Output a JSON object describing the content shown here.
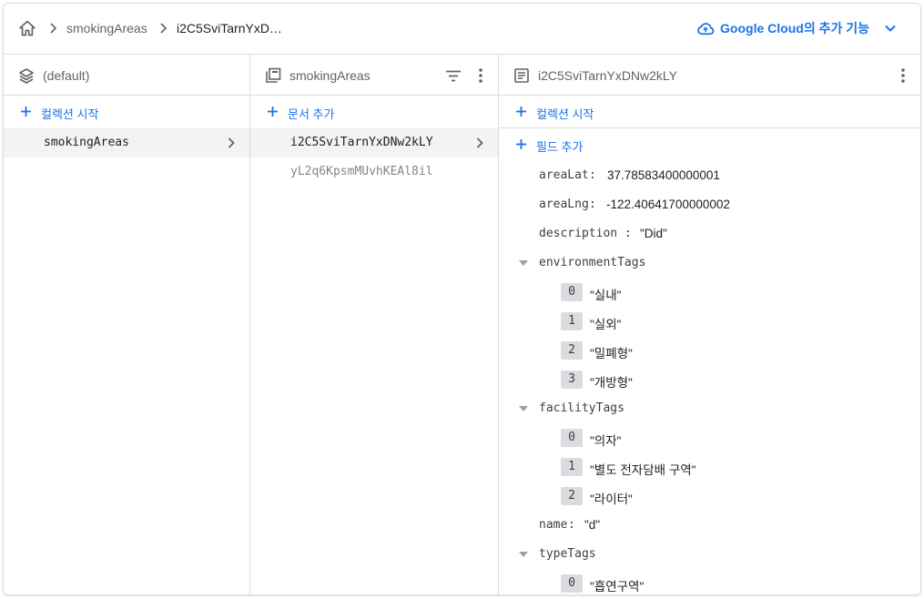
{
  "breadcrumb": {
    "items": [
      "smokingAreas",
      "i2C5SviTarnYxD…"
    ]
  },
  "header": {
    "google_cloud_label": "Google Cloud의 추가 기능"
  },
  "col1": {
    "title": "(default)",
    "action": "컬렉션 시작",
    "items": [
      {
        "label": "smokingAreas"
      }
    ]
  },
  "col2": {
    "title": "smokingAreas",
    "action": "문서 추가",
    "items": [
      {
        "label": "i2C5SviTarnYxDNw2kLY"
      },
      {
        "label": "yL2q6KpsmMUvhKEAl8il"
      }
    ]
  },
  "col3": {
    "title": "i2C5SviTarnYxDNw2kLY",
    "action_collection": "컬렉션 시작",
    "action_field": "필드 추가",
    "fields": {
      "areaLat": {
        "key": "areaLat",
        "value": "37.78583400000001"
      },
      "areaLng": {
        "key": "areaLng",
        "value": "-122.40641700000002"
      },
      "description": {
        "key": "description",
        "value": "\"Did\""
      },
      "environmentTags": {
        "key": "environmentTags",
        "items": [
          {
            "index": "0",
            "value": "\"실내\""
          },
          {
            "index": "1",
            "value": "\"실외\""
          },
          {
            "index": "2",
            "value": "\"밀폐형\""
          },
          {
            "index": "3",
            "value": "\"개방형\""
          }
        ]
      },
      "facilityTags": {
        "key": "facilityTags",
        "items": [
          {
            "index": "0",
            "value": "\"의자\""
          },
          {
            "index": "1",
            "value": "\"별도 전자담배 구역\""
          },
          {
            "index": "2",
            "value": "\"라이터\""
          }
        ]
      },
      "name": {
        "key": "name",
        "value": "\"d\""
      },
      "typeTags": {
        "key": "typeTags",
        "items": [
          {
            "index": "0",
            "value": "\"흡연구역\""
          }
        ]
      }
    }
  },
  "colors": {
    "accent": "#1a73e8",
    "border": "#dadce0",
    "selected": "#f1f3f4"
  }
}
